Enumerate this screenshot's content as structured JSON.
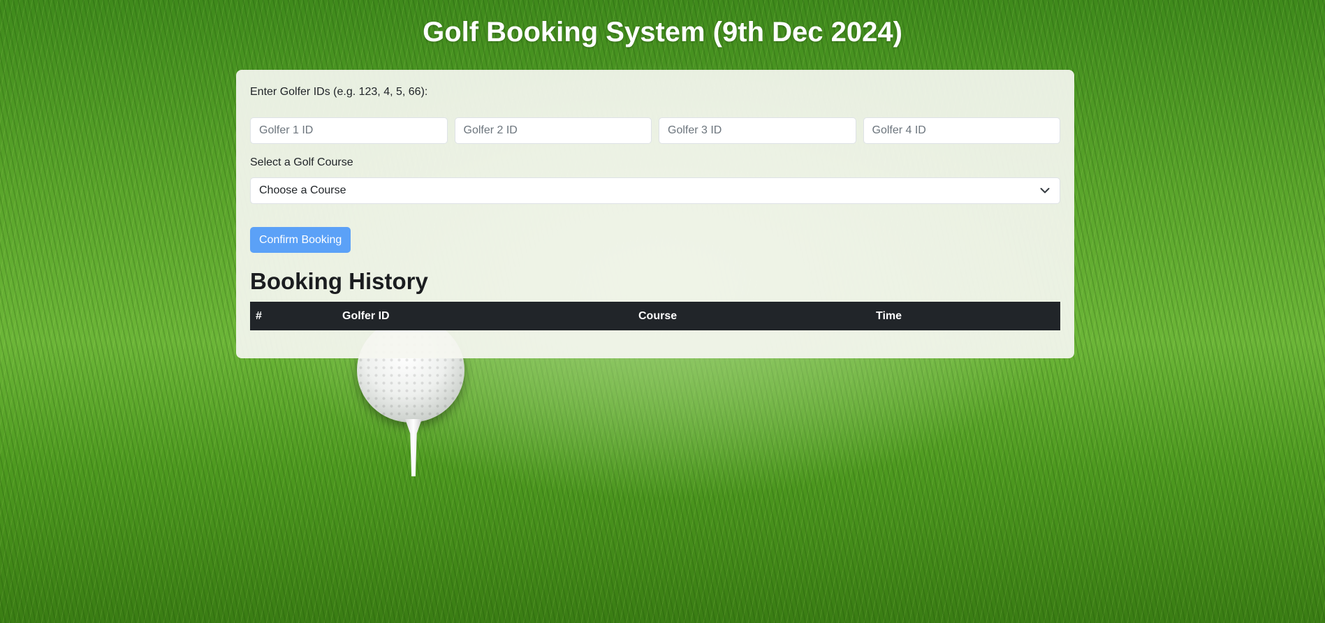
{
  "page": {
    "title": "Golf Booking System (9th Dec 2024)"
  },
  "form": {
    "golfer_ids_label": "Enter Golfer IDs (e.g. 123, 4, 5, 66):",
    "golfer_inputs": [
      {
        "placeholder": "Golfer 1 ID",
        "value": ""
      },
      {
        "placeholder": "Golfer 2 ID",
        "value": ""
      },
      {
        "placeholder": "Golfer 3 ID",
        "value": ""
      },
      {
        "placeholder": "Golfer 4 ID",
        "value": ""
      }
    ],
    "course_label": "Select a Golf Course",
    "course_select": {
      "selected": "Choose a Course"
    },
    "confirm_label": "Confirm Booking"
  },
  "history": {
    "heading": "Booking History",
    "columns": [
      "#",
      "Golfer ID",
      "Course",
      "Time"
    ],
    "rows": []
  },
  "colors": {
    "button": "#5ba1f7",
    "table_header": "#212529",
    "panel": "#f5f6f0"
  },
  "icons": {
    "select_caret": "chevron-down-icon",
    "background": "golf-ball-on-tee-grass"
  }
}
